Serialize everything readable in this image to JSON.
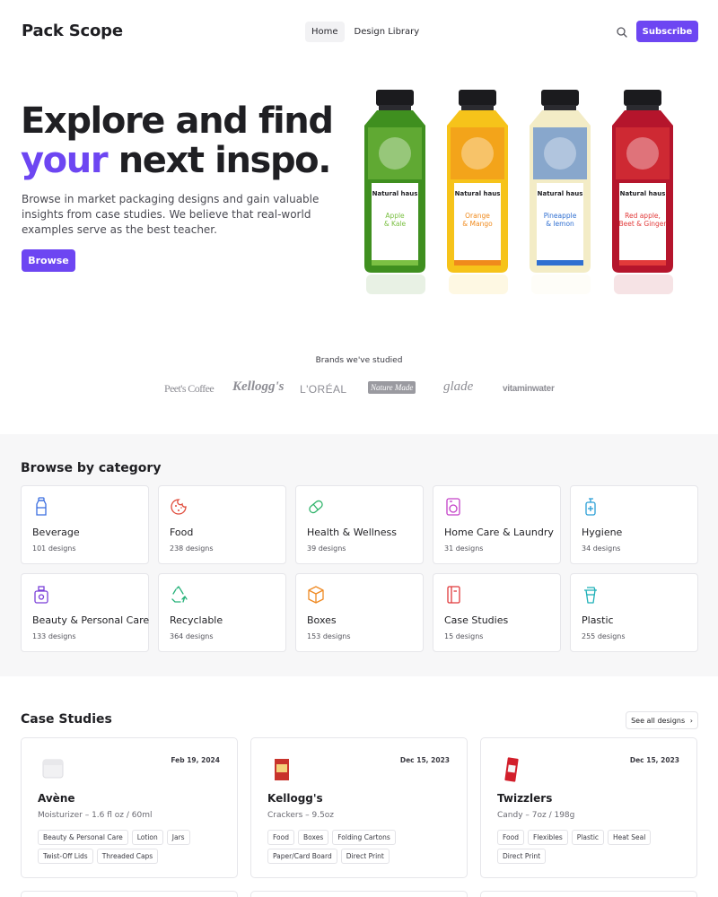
{
  "header": {
    "logo": "Pack Scope",
    "nav": [
      "Home",
      "Design Library"
    ],
    "search_icon": "search-icon",
    "subscribe_label": "Subscribe"
  },
  "hero": {
    "title_line1": "Explore and find",
    "title_accent": "your",
    "title_rest": "next inspo.",
    "subtitle": "Browse in market packaging designs and gain valuable insights from case studies. We believe that real-world examples serve as the best teacher.",
    "cta_label": "Browse",
    "bottles": [
      {
        "brand": "Natural haus",
        "flavor_line1": "Apple",
        "flavor_line2": "& Kale",
        "body": "#3f8f1f",
        "accent": "#7bc043"
      },
      {
        "brand": "Natural haus",
        "flavor_line1": "Orange",
        "flavor_line2": "& Mango",
        "body": "#f6c31a",
        "accent": "#f08a1c"
      },
      {
        "brand": "Natural haus",
        "flavor_line1": "Pineapple",
        "flavor_line2": "& lemon",
        "body": "#f3ecc6",
        "accent": "#2f6fd1"
      },
      {
        "brand": "Natural haus",
        "flavor_line1": "Red apple,",
        "flavor_line2": "Beet & Ginger",
        "body": "#b5152c",
        "accent": "#e23a3a"
      }
    ]
  },
  "brands": {
    "title": "Brands we've studied",
    "logos": [
      "Peet's Coffee",
      "Kellogg's",
      "L'ORÉAL",
      "Nature Made",
      "glade",
      "vitaminwater"
    ]
  },
  "categories": {
    "title": "Browse by category",
    "items": [
      {
        "name": "Beverage",
        "count": "101 designs",
        "icon": "bottle-icon",
        "color": "#3b6ee0"
      },
      {
        "name": "Food",
        "count": "238 designs",
        "icon": "cookie-icon",
        "color": "#e04b3b"
      },
      {
        "name": "Health & Wellness",
        "count": "39 designs",
        "icon": "pill-icon",
        "color": "#2fb36a"
      },
      {
        "name": "Home Care & Laundry",
        "count": "31 designs",
        "icon": "washing-machine-icon",
        "color": "#c440c8"
      },
      {
        "name": "Hygiene",
        "count": "34 designs",
        "icon": "soap-dispenser-icon",
        "color": "#2a9fd6"
      },
      {
        "name": "Beauty & Personal Care",
        "count": "133 designs",
        "icon": "perfume-icon",
        "color": "#7a3fd8"
      },
      {
        "name": "Recyclable",
        "count": "364 designs",
        "icon": "recycle-icon",
        "color": "#27b27a"
      },
      {
        "name": "Boxes",
        "count": "153 designs",
        "icon": "box-icon",
        "color": "#ef8a23"
      },
      {
        "name": "Case Studies",
        "count": "15 designs",
        "icon": "notebook-icon",
        "color": "#e0393b"
      },
      {
        "name": "Plastic",
        "count": "255 designs",
        "icon": "cup-icon",
        "color": "#1fb0b8"
      }
    ]
  },
  "case_studies": {
    "title": "Case Studies",
    "see_all_label": "See all designs",
    "items": [
      {
        "name": "Avène",
        "date": "Feb 19, 2024",
        "desc": "Moisturizer – 1.6 fl oz / 60ml",
        "tags": [
          "Beauty & Personal Care",
          "Lotion",
          "Jars",
          "Twist-Off Lids",
          "Threaded Caps"
        ]
      },
      {
        "name": "Kellogg's",
        "date": "Dec 15, 2023",
        "desc": "Crackers – 9.5oz",
        "tags": [
          "Food",
          "Boxes",
          "Folding Cartons",
          "Paper/Card Board",
          "Direct Print"
        ]
      },
      {
        "name": "Twizzlers",
        "date": "Dec 15, 2023",
        "desc": "Candy – 7oz / 198g",
        "tags": [
          "Food",
          "Flexibles",
          "Plastic",
          "Heat Seal",
          "Direct Print"
        ]
      }
    ]
  }
}
